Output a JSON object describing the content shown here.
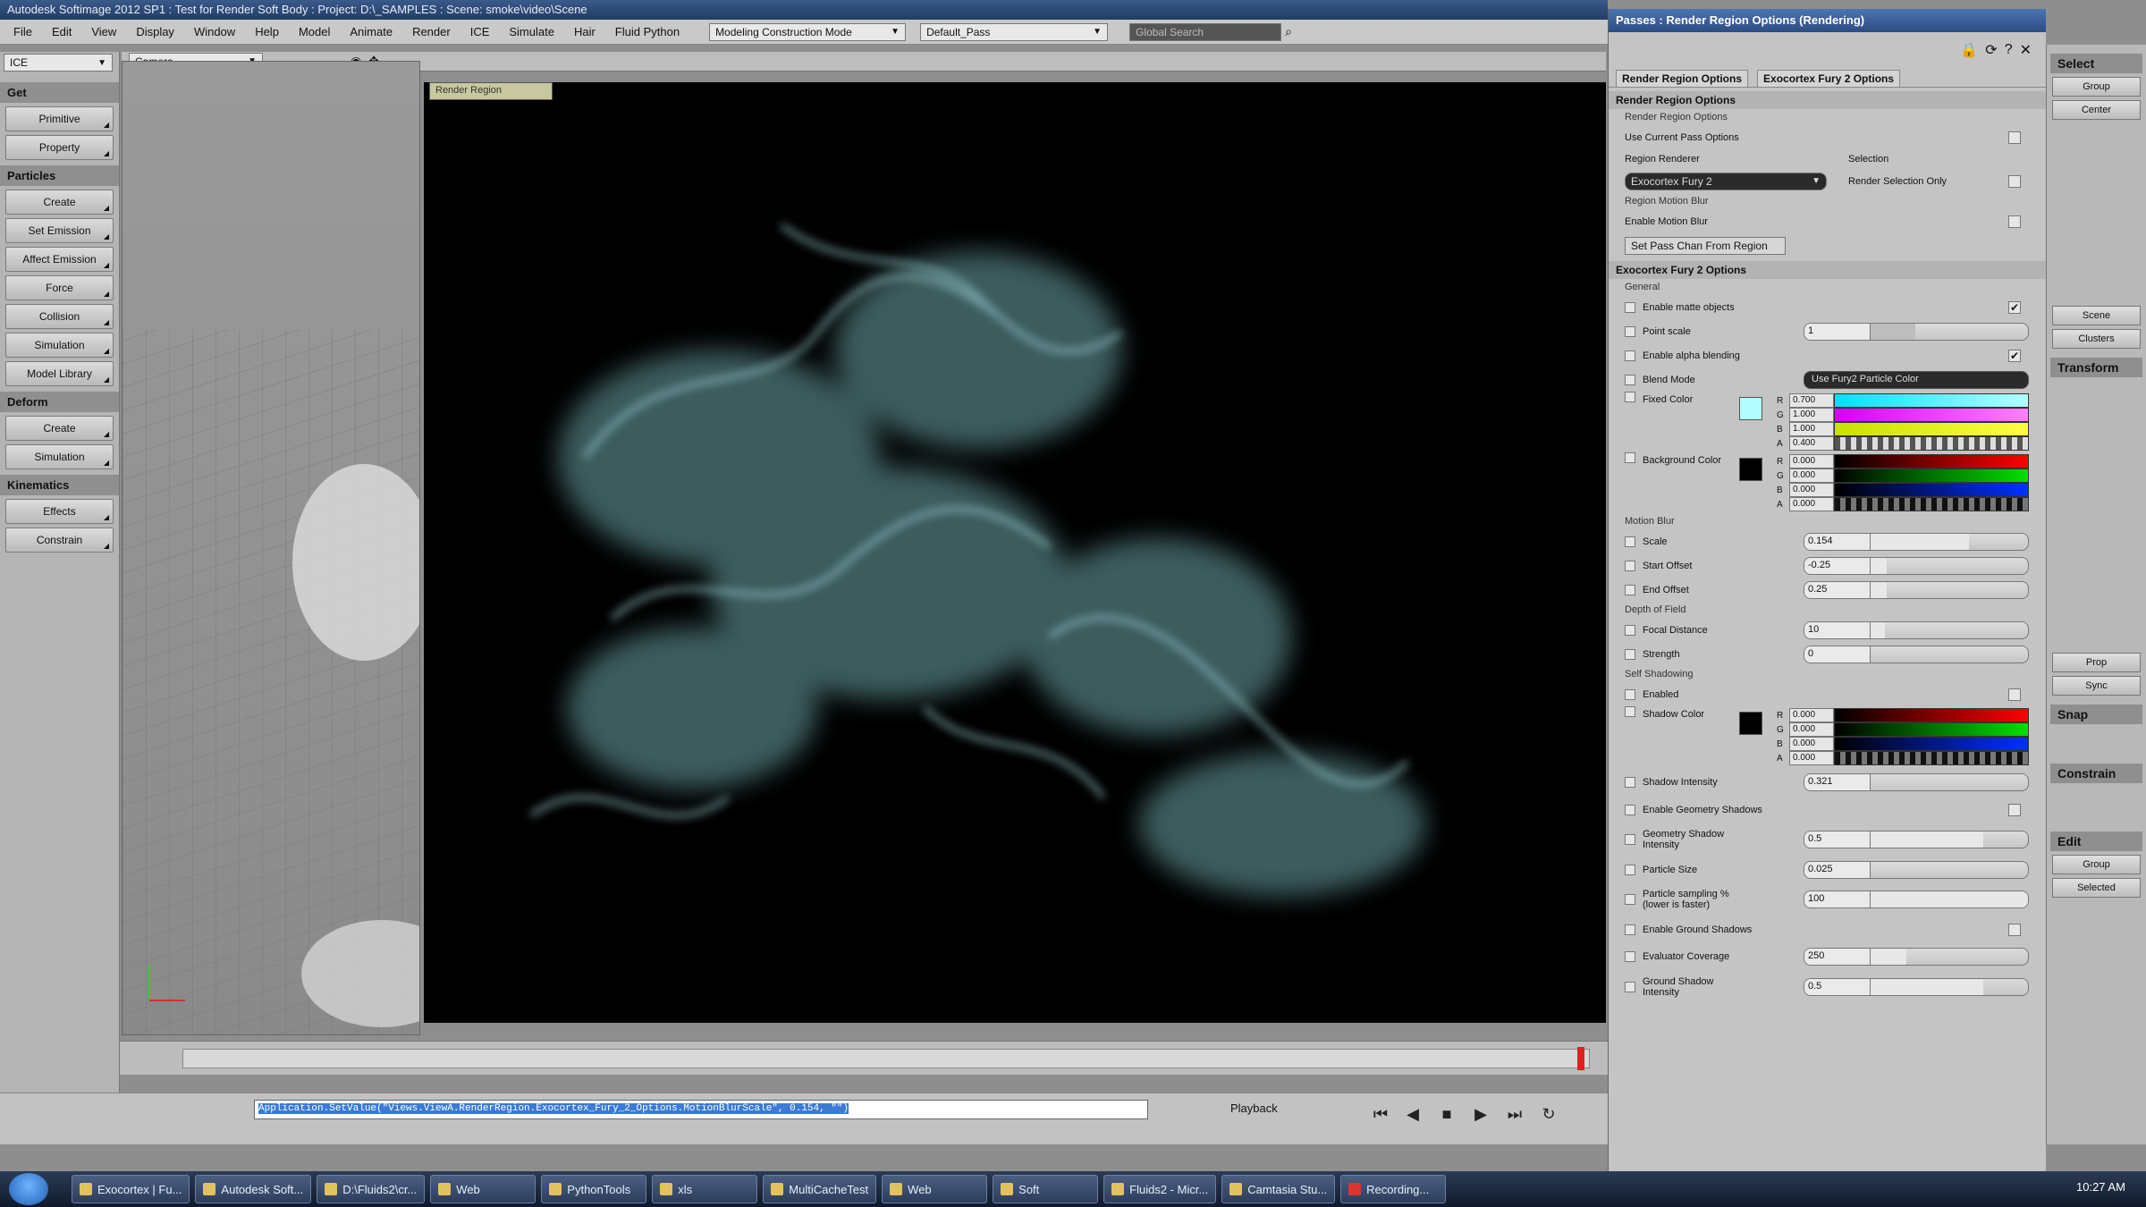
{
  "window": {
    "title": "Autodesk Softimage 2012 SP1 : Test for Render Soft Body : Project: D:\\_SAMPLES : Scene: smoke\\video\\Scene"
  },
  "menu": {
    "items": [
      "File",
      "Edit",
      "View",
      "Display",
      "Window",
      "Help",
      "Model",
      "Animate",
      "Render",
      "ICE",
      "Simulate",
      "Hair",
      "Fluid Python"
    ],
    "construction_mode": "Modeling Construction Mode",
    "pass": "Default_Pass",
    "search_placeholder": "Global Search"
  },
  "leftbar": {
    "mode": "ICE",
    "sections": [
      {
        "title": "Get",
        "buttons": [
          "Primitive",
          "Property"
        ]
      },
      {
        "title": "Particles",
        "buttons": [
          "Create",
          "Set Emission",
          "Affect Emission",
          "Force",
          "Collision",
          "Simulation",
          "Model Library"
        ]
      },
      {
        "title": "Deform",
        "buttons": [
          "Create",
          "Simulation"
        ]
      },
      {
        "title": "Kinematics",
        "buttons": [
          "Effects",
          "Constrain"
        ]
      }
    ]
  },
  "viewport": {
    "camera": "Camera",
    "render_tab": "Render Region"
  },
  "command": {
    "text": "Application.SetValue(\"Views.ViewA.RenderRegion.Exocortex_Fury_2_Options.MotionBlurScale\", 0.154, \"\")"
  },
  "playback": {
    "label": "Playback"
  },
  "panel": {
    "title": "Passes : Render Region Options (Rendering)",
    "tabs": [
      "Render Region Options",
      "Exocortex Fury 2 Options"
    ],
    "render_region": {
      "header": "Render Region Options",
      "sub": "Render Region Options",
      "use_current_pass": "Use Current Pass Options",
      "renderer_label": "Region Renderer",
      "renderer": "Exocortex Fury 2",
      "selection_label": "Selection",
      "selection_only": "Render Selection Only",
      "motion_blur_label": "Region Motion Blur",
      "enable_motion_blur": "Enable Motion Blur",
      "set_pass_btn": "Set Pass Chan From Region"
    },
    "fury": {
      "header": "Exocortex Fury 2 Options",
      "general_label": "General",
      "matte": "Enable matte objects",
      "point_scale_label": "Point scale",
      "point_scale": "1",
      "alpha": "Enable alpha blending",
      "blend_label": "Blend Mode",
      "blend": "Use Fury2 Particle Color",
      "fixed_color_label": "Fixed Color",
      "fixed": {
        "r": "0.700",
        "g": "1.000",
        "b": "1.000",
        "a": "0.400"
      },
      "bg_label": "Background Color",
      "bg": {
        "r": "0.000",
        "g": "0.000",
        "b": "0.000",
        "a": "0.000"
      },
      "motion_blur_label": "Motion Blur",
      "mb_scale_label": "Scale",
      "mb_scale": "0.154",
      "mb_start_label": "Start Offset",
      "mb_start": "-0.25",
      "mb_end_label": "End Offset",
      "mb_end": "0.25",
      "dof_label": "Depth of Field",
      "focal_label": "Focal Distance",
      "focal": "10",
      "strength_label": "Strength",
      "strength": "0",
      "shadow_label": "Self Shadowing",
      "shadow_enabled": "Enabled",
      "shadow_color_label": "Shadow Color",
      "shadow": {
        "r": "0.000",
        "g": "0.000",
        "b": "0.000",
        "a": "0.000"
      },
      "shadow_intensity_label": "Shadow Intensity",
      "shadow_intensity": "0.321",
      "geo_shadows": "Enable Geometry Shadows",
      "geo_intensity_label": "Geometry Shadow Intensity",
      "geo_intensity": "0.5",
      "particle_size_label": "Particle Size",
      "particle_size": "0.025",
      "sampling_label": "Particle sampling % (lower is faster)",
      "sampling": "100",
      "ground": "Enable Ground Shadows",
      "evaluator_label": "Evaluator Coverage",
      "evaluator": "250",
      "ground_intensity_label": "Ground Shadow Intensity",
      "ground_intensity": "0.5"
    }
  },
  "rightbar": {
    "top": "Select",
    "buttons": [
      "Group",
      "Center",
      "Scene",
      "Clusters"
    ],
    "transform": "Transform",
    "snap": "Snap",
    "constrain": "Constrain",
    "edit": "Edit",
    "misc": [
      "Prop",
      "Sync",
      "Group",
      "Selected"
    ]
  },
  "taskbar": {
    "items": [
      "Exocortex | Fu...",
      "Autodesk Soft...",
      "D:\\Fluids2\\cr...",
      "Web",
      "PythonTools",
      "xls",
      "MultiCacheTest",
      "Web",
      "Soft",
      "Fluids2 - Micr...",
      "Camtasia Stu...",
      "Recording..."
    ],
    "clock": "10:27 AM"
  },
  "colors": {
    "accent": "#3a7bd5",
    "smoke": "#8fd1d6"
  }
}
